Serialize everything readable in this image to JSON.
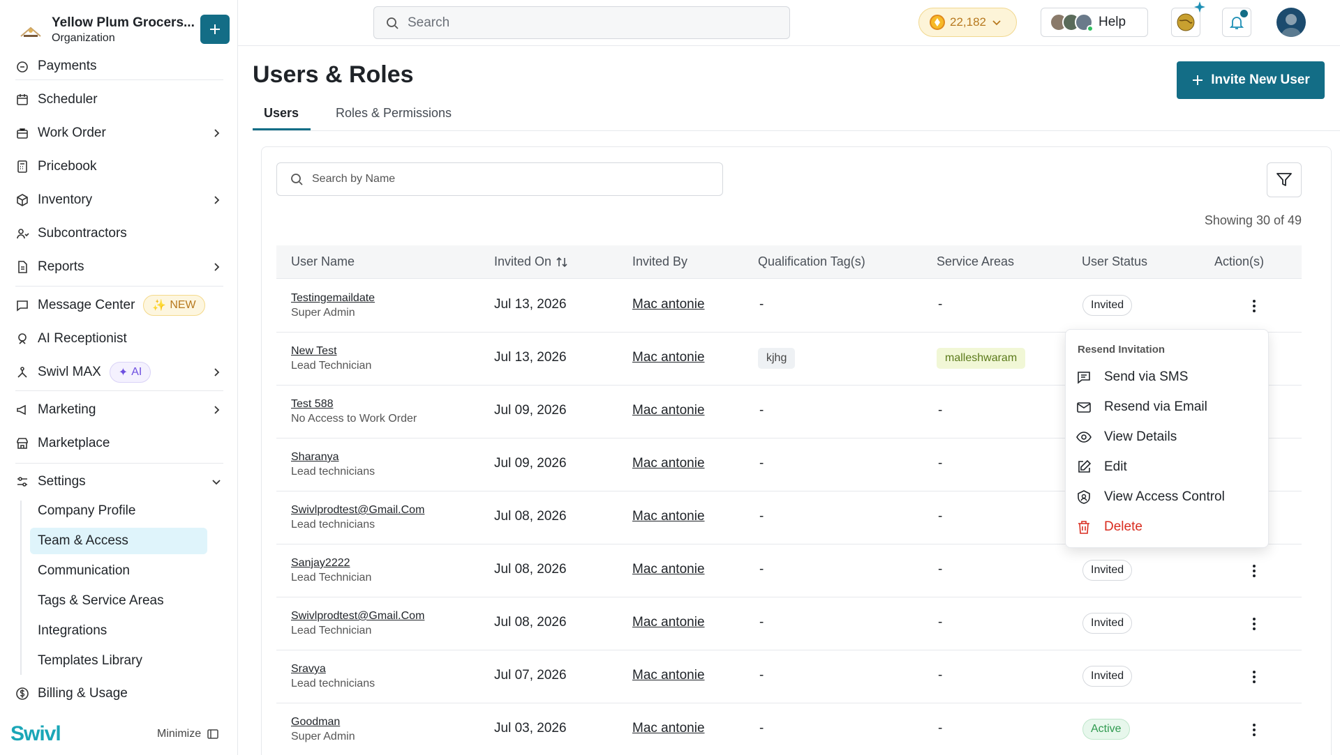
{
  "org": {
    "name": "Yellow Plum Grocers...",
    "type": "Organization"
  },
  "sidebar": {
    "items": [
      {
        "label": "Payments"
      },
      {
        "label": "Scheduler"
      },
      {
        "label": "Work Order"
      },
      {
        "label": "Pricebook"
      },
      {
        "label": "Inventory"
      },
      {
        "label": "Subcontractors"
      },
      {
        "label": "Reports"
      },
      {
        "label": "Message Center",
        "badge": "NEW"
      },
      {
        "label": "AI Receptionist"
      },
      {
        "label": "Swivl MAX",
        "badge": "AI"
      },
      {
        "label": "Marketing"
      },
      {
        "label": "Marketplace"
      },
      {
        "label": "Settings"
      }
    ],
    "settings_sub": [
      {
        "label": "Company Profile"
      },
      {
        "label": "Team & Access",
        "active": true
      },
      {
        "label": "Communication"
      },
      {
        "label": "Tags & Service Areas"
      },
      {
        "label": "Integrations"
      },
      {
        "label": "Templates Library"
      }
    ],
    "billing": "Billing & Usage",
    "brand": "Swivl",
    "minimize": "Minimize"
  },
  "header": {
    "search_placeholder": "Search",
    "coins": "22,182",
    "help": "Help"
  },
  "main": {
    "title": "Users & Roles",
    "invite_button": "Invite New User",
    "tabs": [
      {
        "label": "Users",
        "active": true
      },
      {
        "label": "Roles & Permissions"
      }
    ],
    "name_search_placeholder": "Search by Name",
    "showing": "Showing 30 of 49",
    "columns": [
      "User Name",
      "Invited On",
      "Invited By",
      "Qualification Tag(s)",
      "Service Areas",
      "User Status",
      "Action(s)"
    ],
    "rows": [
      {
        "name": "Testingemaildate",
        "role": "Super Admin",
        "invited_on": "Jul 13, 2026",
        "invited_by": "Mac antonie",
        "qual": "-",
        "area": "-",
        "status": "Invited"
      },
      {
        "name": "New Test",
        "role": "Lead Technician",
        "invited_on": "Jul 13, 2026",
        "invited_by": "Mac antonie",
        "qual": "kjhg",
        "area": "malleshwaram",
        "status": ""
      },
      {
        "name": "Test 588",
        "role": "No Access to Work Order",
        "invited_on": "Jul 09, 2026",
        "invited_by": "Mac antonie",
        "qual": "-",
        "area": "-",
        "status": ""
      },
      {
        "name": "Sharanya",
        "role": "Lead technicians",
        "invited_on": "Jul 09, 2026",
        "invited_by": "Mac antonie",
        "qual": "-",
        "area": "-",
        "status": ""
      },
      {
        "name": "Swivlprodtest@Gmail.Com",
        "role": "Lead technicians",
        "invited_on": "Jul 08, 2026",
        "invited_by": "Mac antonie",
        "qual": "-",
        "area": "-",
        "status": ""
      },
      {
        "name": "Sanjay2222",
        "role": "Lead Technician",
        "invited_on": "Jul 08, 2026",
        "invited_by": "Mac antonie",
        "qual": "-",
        "area": "-",
        "status": "Invited"
      },
      {
        "name": "Swivlprodtest@Gmail.Com",
        "role": "Lead Technician",
        "invited_on": "Jul 08, 2026",
        "invited_by": "Mac antonie",
        "qual": "-",
        "area": "-",
        "status": "Invited"
      },
      {
        "name": "Sravya",
        "role": "Lead technicians",
        "invited_on": "Jul 07, 2026",
        "invited_by": "Mac antonie",
        "qual": "-",
        "area": "-",
        "status": "Invited"
      },
      {
        "name": "Goodman",
        "role": "Super Admin",
        "invited_on": "Jul 03, 2026",
        "invited_by": "Mac antonie",
        "qual": "-",
        "area": "-",
        "status": "Active"
      }
    ]
  },
  "menu": {
    "header": "Resend Invitation",
    "items": [
      {
        "label": "Send via SMS",
        "icon": "message-icon"
      },
      {
        "label": "Resend via Email",
        "icon": "mail-icon"
      },
      {
        "label": "View Details",
        "icon": "eye-icon"
      },
      {
        "label": "Edit",
        "icon": "edit-icon"
      },
      {
        "label": "View Access Control",
        "icon": "shield-icon"
      },
      {
        "label": "Delete",
        "icon": "trash-icon"
      }
    ]
  },
  "colors": {
    "primary": "#136d86",
    "active_nav": "#dff4fb",
    "danger": "#d92d20",
    "active_status": "#2f9a4f"
  }
}
